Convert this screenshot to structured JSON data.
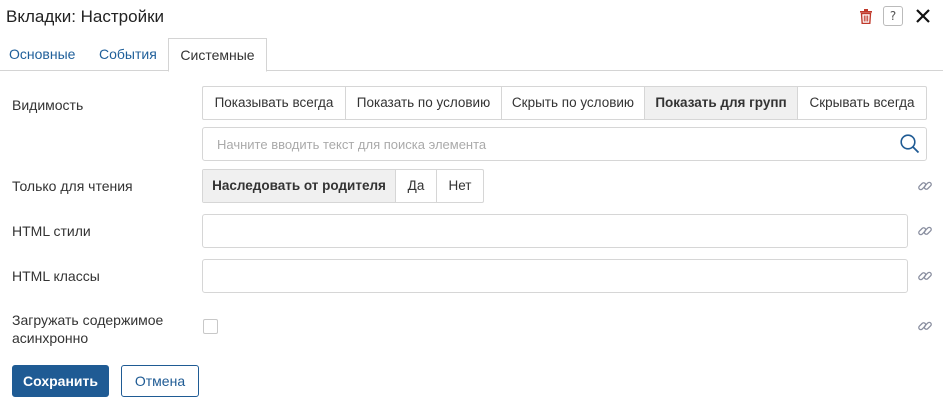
{
  "window": {
    "title": "Вкладки: Настройки"
  },
  "header": {
    "help_label": "?"
  },
  "tabs": [
    {
      "label": "Основные"
    },
    {
      "label": "События"
    },
    {
      "label": "Системные",
      "active": true
    }
  ],
  "visibility": {
    "label": "Видимость",
    "options": [
      {
        "label": "Показывать всегда"
      },
      {
        "label": "Показать по условию"
      },
      {
        "label": "Скрыть по условию"
      },
      {
        "label": "Показать для групп",
        "selected": true
      },
      {
        "label": "Скрывать всегда"
      }
    ],
    "search": {
      "placeholder": "Начните вводить текст для поиска элемента",
      "value": ""
    }
  },
  "readonly": {
    "label": "Только для чтения",
    "options": [
      {
        "label": "Наследовать от родителя",
        "selected": true
      },
      {
        "label": "Да"
      },
      {
        "label": "Нет"
      }
    ]
  },
  "html_styles": {
    "label": "HTML стили",
    "value": ""
  },
  "html_classes": {
    "label": "HTML классы",
    "value": ""
  },
  "async_load": {
    "label_line1": "Загружать содержимое",
    "label_line2": "асинхронно",
    "checked": false
  },
  "buttons": {
    "save": "Сохранить",
    "cancel": "Отмена"
  },
  "colors": {
    "primary": "#1f5b94",
    "trash": "#c0392b",
    "link_icon": "#8a8fa0"
  },
  "icons": {
    "trash": "trash-icon",
    "help": "help-icon",
    "close": "close-icon",
    "search": "search-icon",
    "link": "link-icon"
  }
}
